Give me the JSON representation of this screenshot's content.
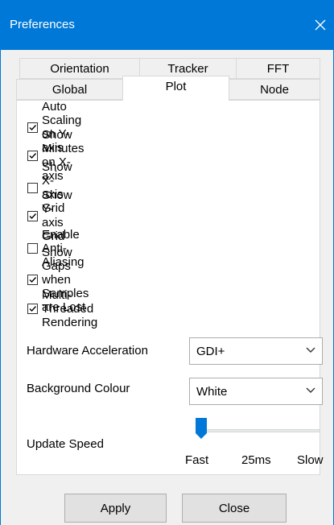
{
  "window": {
    "title": "Preferences"
  },
  "tabs": {
    "row1": [
      "Orientation",
      "Tracker",
      "FFT"
    ],
    "row2": [
      "Global",
      "Plot",
      "Node"
    ],
    "selected": "Plot"
  },
  "checkboxes": [
    {
      "label": "Auto Scaling on Y-axis",
      "checked": true
    },
    {
      "label": "Show Minutes on X-axis",
      "checked": true
    },
    {
      "label": "Show X-axis Grid",
      "checked": false
    },
    {
      "label": "Show Y-axis Grid",
      "checked": true
    },
    {
      "label": "Enable Anti-Aliasing",
      "checked": false
    },
    {
      "label": "Show Gaps when Samples are Lost",
      "checked": true
    },
    {
      "label": "Multi-Threaded Rendering",
      "checked": true
    }
  ],
  "hardware": {
    "label": "Hardware Acceleration",
    "value": "GDI+"
  },
  "background": {
    "label": "Background Colour",
    "value": "White"
  },
  "update_speed": {
    "label": "Update Speed",
    "min_label": "Fast",
    "value_label": "25ms",
    "max_label": "Slow",
    "level": 0
  },
  "buttons": {
    "apply": "Apply",
    "close": "Close"
  },
  "colors": {
    "titlebar": "#0078d7",
    "check": "#000000"
  }
}
